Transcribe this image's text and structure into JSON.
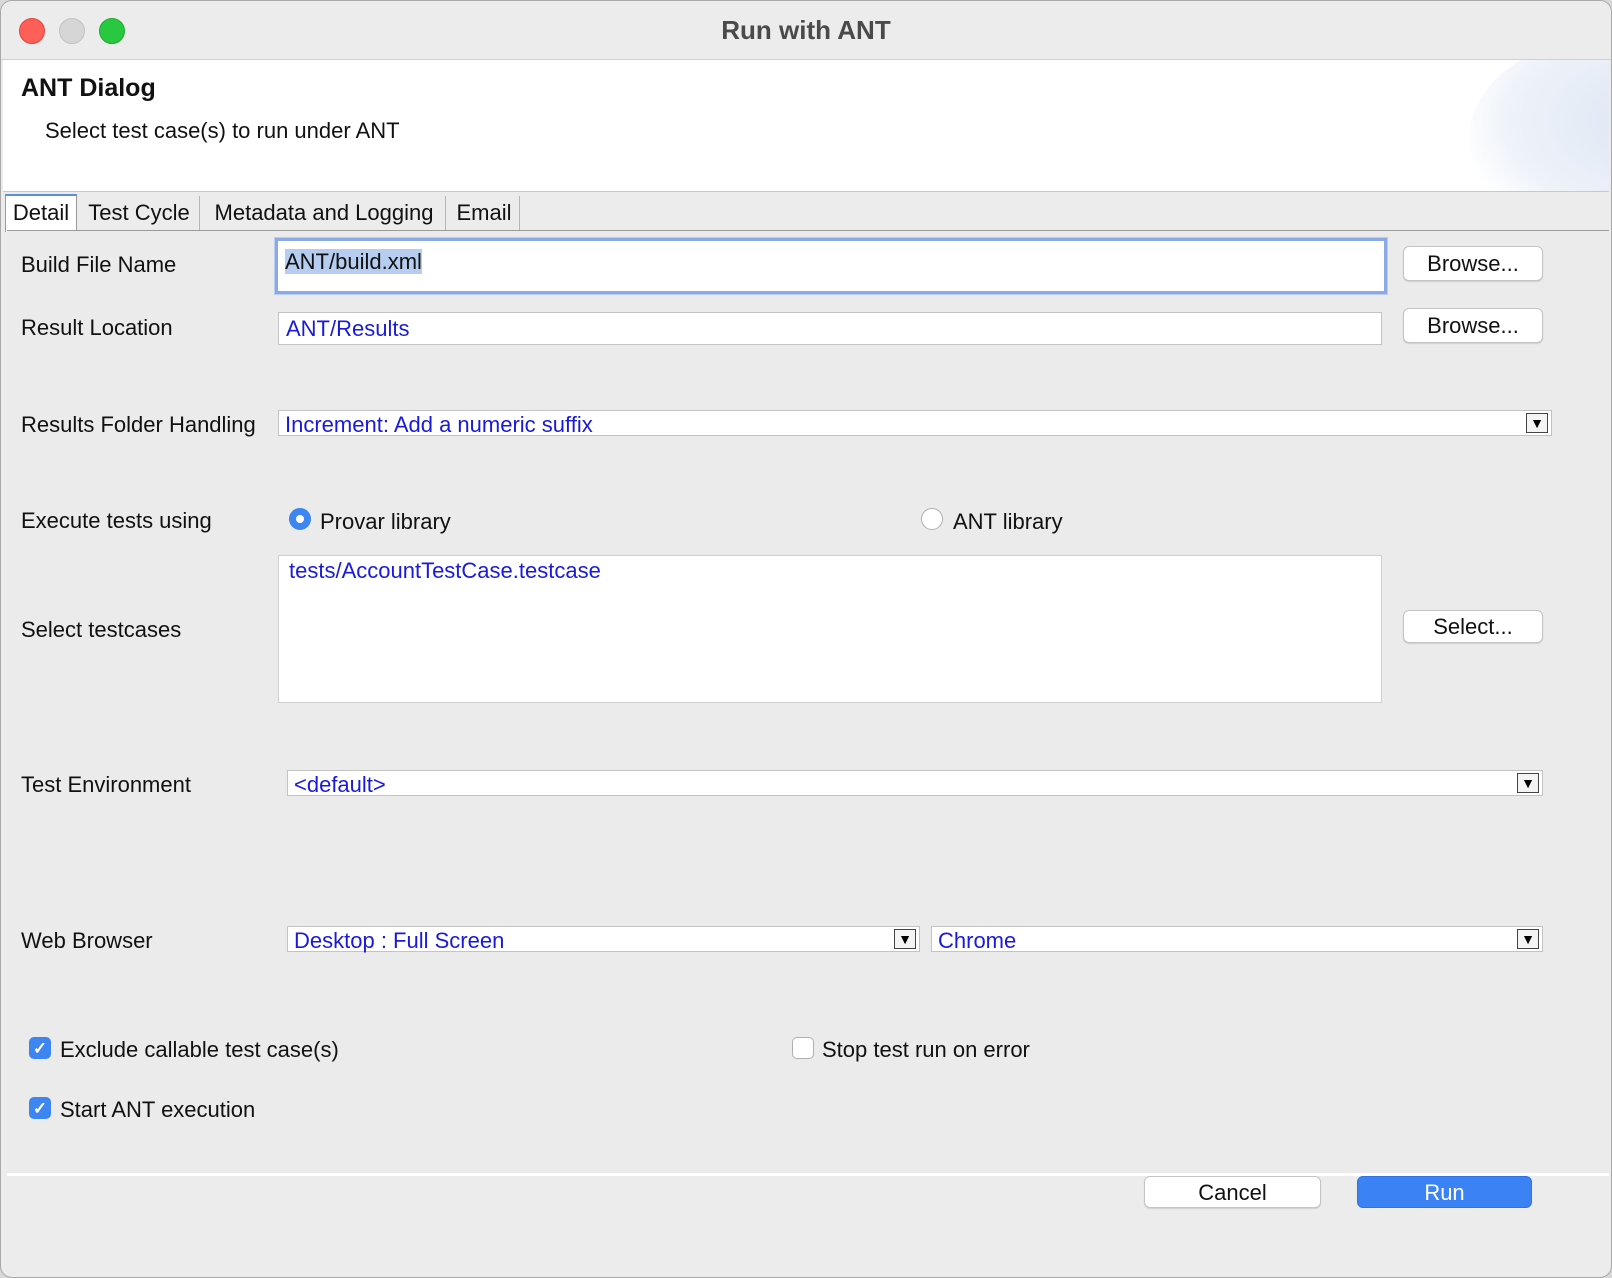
{
  "window": {
    "title": "Run with ANT"
  },
  "header": {
    "title": "ANT Dialog",
    "description": "Select test case(s) to run under ANT"
  },
  "tabs": [
    {
      "label": "Detail",
      "active": true
    },
    {
      "label": "Test Cycle"
    },
    {
      "label": "Metadata and Logging"
    },
    {
      "label": "Email"
    }
  ],
  "form": {
    "build_file": {
      "label": "Build File Name",
      "value": "ANT/build.xml",
      "browse_label": "Browse..."
    },
    "result_location": {
      "label": "Result Location",
      "value": "ANT/Results",
      "browse_label": "Browse..."
    },
    "results_folder_handling": {
      "label": "Results Folder Handling",
      "value": "Increment: Add a numeric suffix"
    },
    "execute_using": {
      "label": "Execute tests using",
      "options": [
        {
          "label": "Provar library",
          "selected": true
        },
        {
          "label": "ANT library",
          "selected": false
        }
      ]
    },
    "testcases": {
      "label": "Select testcases",
      "items": [
        "tests/AccountTestCase.testcase"
      ],
      "select_label": "Select..."
    },
    "test_environment": {
      "label": "Test Environment",
      "value": "<default>"
    },
    "web_browser": {
      "label": "Web Browser",
      "resolution": "Desktop : Full Screen",
      "browser": "Chrome"
    },
    "checkboxes": {
      "exclude_callable": {
        "label": "Exclude callable test case(s)",
        "checked": true
      },
      "stop_on_error": {
        "label": "Stop test run on error",
        "checked": false
      },
      "start_ant": {
        "label": "Start ANT execution",
        "checked": true
      }
    }
  },
  "footer": {
    "cancel_label": "Cancel",
    "run_label": "Run"
  },
  "icons": {
    "dropdown": "▼",
    "check": "✓"
  },
  "colors": {
    "accent": "#3b83f5",
    "value_text": "#1a1adc"
  }
}
